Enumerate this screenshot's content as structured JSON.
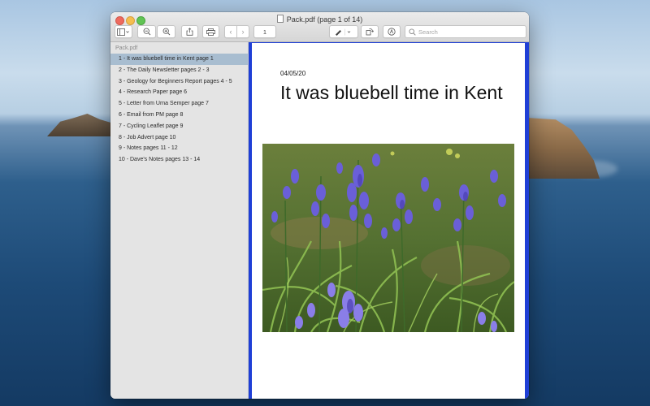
{
  "window": {
    "title": "Pack.pdf (page 1 of 14)"
  },
  "toolbar": {
    "page_number": "1",
    "search_placeholder": "Search"
  },
  "sidebar": {
    "header": "Pack.pdf",
    "items": [
      {
        "label": "1 - It was bluebell time in Kent page 1",
        "selected": true
      },
      {
        "label": "2 - The Daily Newsletter pages 2 - 3"
      },
      {
        "label": "3 - Geology for Beginners Report pages 4 - 5"
      },
      {
        "label": "4 - Research Paper page 6"
      },
      {
        "label": "5 - Letter from Urna Semper page 7"
      },
      {
        "label": "6 - Email from PM page 8"
      },
      {
        "label": "7 - Cycling Leaflet page 9"
      },
      {
        "label": "8 - Job Advert page 10"
      },
      {
        "label": "9 - Notes pages 11 - 12"
      },
      {
        "label": "10 - Dave's Notes pages 13 - 14"
      }
    ]
  },
  "document": {
    "date": "04/05/20",
    "heading": "It was bluebell time in Kent"
  },
  "colors": {
    "selection": "#a8bdd0",
    "page_frame": "#1f3fd6"
  }
}
